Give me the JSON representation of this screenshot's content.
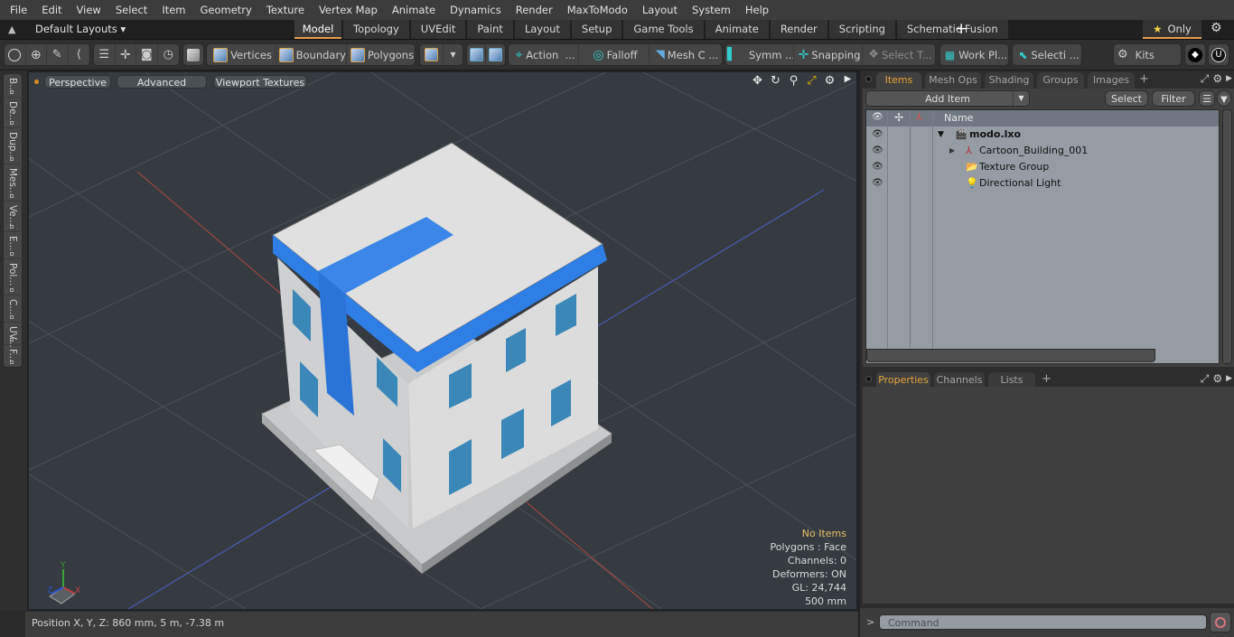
{
  "menu": [
    "File",
    "Edit",
    "View",
    "Select",
    "Item",
    "Geometry",
    "Texture",
    "Vertex Map",
    "Animate",
    "Dynamics",
    "Render",
    "MaxToModo",
    "Layout",
    "System",
    "Help"
  ],
  "layoutbar": {
    "layouts_label": "Default Layouts ▾",
    "tabs": [
      "Model",
      "Topology",
      "UVEdit",
      "Paint",
      "Layout",
      "Setup",
      "Game Tools",
      "Animate",
      "Render",
      "Scripting",
      "Schematic Fusion"
    ],
    "active_tab": "Model",
    "add_tab": "+",
    "only_label": "Only",
    "accent_color": "#e3a048"
  },
  "toolbar": {
    "vertices": "Vertices",
    "boundary": "Boundary",
    "polygons": "Polygons",
    "action": "Action",
    "falloff": "Falloff",
    "mesh": "Mesh C ...",
    "symm": "Symm ...",
    "snapping": "Snapping",
    "select_t": "Select T...",
    "work_pl": "Work Pl...",
    "selecti": "Selecti ...",
    "kits": "Kits",
    "ellipsis": "..."
  },
  "left_tabs": [
    "B...",
    "De...",
    "Dup...",
    "Mes...",
    "Ve...",
    "E...",
    "Pol...",
    "C...",
    "UV...",
    "F..."
  ],
  "viewport": {
    "perspective": "Perspective",
    "advanced": "Advanced",
    "textures": "Viewport Textures",
    "stats": {
      "no_items": "No Items",
      "polygons": "Polygons : Face",
      "channels": "Channels: 0",
      "deformers": "Deformers: ON",
      "gl": "GL: 24,744",
      "scale": "500 mm"
    },
    "axis": {
      "x": "X",
      "y": "Y",
      "z": "Z"
    }
  },
  "status": {
    "position": "Position X, Y, Z:   860 mm, 5 m, -7.38 m"
  },
  "items_panel": {
    "tabs": [
      "Items",
      "Mesh Ops",
      "Shading",
      "Groups",
      "Images"
    ],
    "active_tab": "Items",
    "add_tab": "+",
    "add_item": "Add Item",
    "select": "Select",
    "filter": "Filter",
    "name_header": "Name",
    "tree": [
      {
        "label": "modo.lxo",
        "icon": "scene-icon",
        "bold": true
      },
      {
        "label": "Cartoon_Building_001",
        "icon": "locator-icon"
      },
      {
        "label": "Texture Group",
        "icon": "folder-icon"
      },
      {
        "label": "Directional Light",
        "icon": "light-icon"
      }
    ]
  },
  "properties_panel": {
    "tabs": [
      "Properties",
      "Channels",
      "Lists"
    ],
    "active_tab": "Properties",
    "add_tab": "+"
  },
  "command": {
    "prompt": ">",
    "placeholder": "Command"
  },
  "colors": {
    "building_blue": "#2f7ee6",
    "building_wall": "#d9d9d9",
    "window_glass": "#3b88b8",
    "viewport_bg": "#353b40",
    "tree_bg": "#959ca3"
  }
}
